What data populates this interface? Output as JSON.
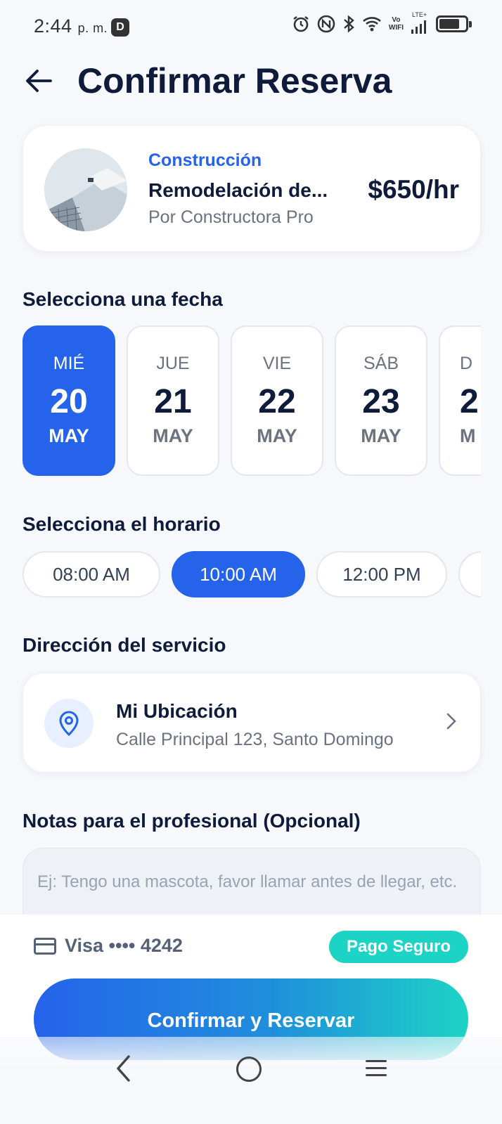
{
  "status_bar": {
    "time": "2:44",
    "ampm": "p. m.",
    "d_badge": "D",
    "wifi_vo": "Vo",
    "wifi_label": "WIFI",
    "lte": "LTE+"
  },
  "header": {
    "title": "Confirmar Reserva"
  },
  "service": {
    "category": "Construcción",
    "name": "Remodelación de...",
    "price": "$650/hr",
    "provider": "Por Constructora Pro"
  },
  "dates_section": {
    "title": "Selecciona una fecha",
    "items": [
      {
        "dow": "MIÉ",
        "day": "20",
        "month": "MAY",
        "selected": true
      },
      {
        "dow": "JUE",
        "day": "21",
        "month": "MAY",
        "selected": false
      },
      {
        "dow": "VIE",
        "day": "22",
        "month": "MAY",
        "selected": false
      },
      {
        "dow": "SÁB",
        "day": "23",
        "month": "MAY",
        "selected": false
      },
      {
        "dow": "D",
        "day": "2",
        "month": "M",
        "selected": false
      }
    ]
  },
  "times_section": {
    "title": "Selecciona el horario",
    "items": [
      {
        "label": "08:00 AM",
        "selected": false
      },
      {
        "label": "10:00 AM",
        "selected": true
      },
      {
        "label": "12:00 PM",
        "selected": false
      },
      {
        "label": "",
        "selected": false
      }
    ]
  },
  "address_section": {
    "title": "Dirección del servicio",
    "location_name": "Mi Ubicación",
    "location_address": "Calle Principal 123, Santo Domingo"
  },
  "notes_section": {
    "title": "Notas para el profesional (Opcional)",
    "placeholder": "Ej: Tengo una mascota, favor llamar antes de llegar, etc."
  },
  "payment": {
    "card_label": "Visa •••• 4242",
    "secure_badge": "Pago Seguro",
    "confirm_button": "Confirmar y Reservar"
  },
  "colors": {
    "primary": "#2563eb",
    "accent": "#1dd3c5",
    "title": "#0f1b3a",
    "muted": "#6b7280"
  }
}
